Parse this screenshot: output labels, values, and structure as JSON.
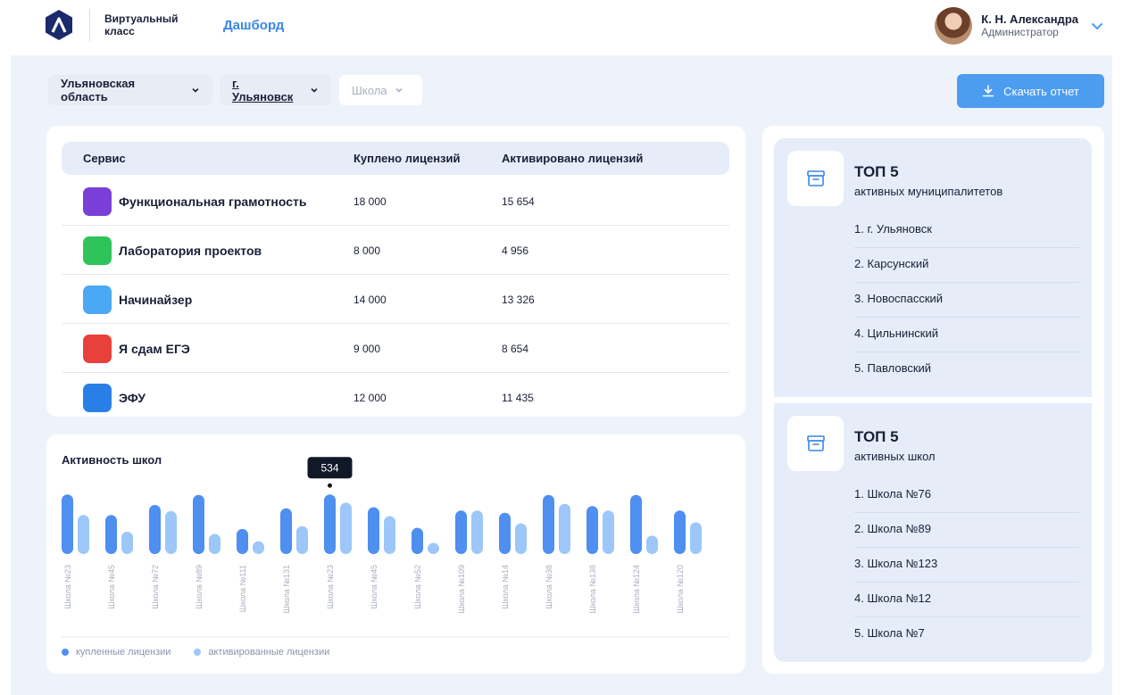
{
  "header": {
    "brand": "Виртуальный класс",
    "nav_dashboard": "Дашборд",
    "user_name": "К. Н. Александра",
    "user_role": "Администратор"
  },
  "filters": {
    "region": "Ульяновская область",
    "city": "г. Ульяновск",
    "school_placeholder": "Школа"
  },
  "download_label": "Скачать отчет",
  "services": {
    "columns": [
      "Сервис",
      "Куплено лицензий",
      "Активировано лицензий"
    ],
    "rows": [
      {
        "name": "Функциональная грамотность",
        "bought": "18 000",
        "activated": "15 654",
        "icon": "puzzle-icon",
        "color": "#7a3fd6"
      },
      {
        "name": "Лаборатория проектов",
        "bought": "8 000",
        "activated": "4 956",
        "icon": "shapes-icon",
        "color": "#2fc45a"
      },
      {
        "name": "Начинайзер",
        "bought": "14 000",
        "activated": "13 326",
        "icon": "kids-icon",
        "color": "#4aa8f5"
      },
      {
        "name": "Я сдам ЕГЭ",
        "bought": "9 000",
        "activated": "8 654",
        "icon": "exam-icon",
        "color": "#e8403a"
      },
      {
        "name": "ЭФУ",
        "bought": "12 000",
        "activated": "11 435",
        "icon": "book-icon",
        "color": "#2a7fe6"
      }
    ]
  },
  "activity": {
    "title": "Активность школ",
    "tooltip_value": "534",
    "legend_bought": "купленные лицензии",
    "legend_activated": "активированные лицензии"
  },
  "chart_data": {
    "type": "bar",
    "categories": [
      "Школа №23",
      "Школа №45",
      "Школа №72",
      "Школа №89",
      "Школа №111",
      "Школа №131",
      "Школа №23",
      "Школа №45",
      "Школа №52",
      "Школа №109",
      "Школа №14",
      "Школа №38",
      "Школа №138",
      "Школа №124",
      "Школа №120"
    ],
    "series": [
      {
        "name": "купленные лицензии",
        "values": [
          534,
          350,
          440,
          530,
          225,
          410,
          534,
          420,
          235,
          390,
          370,
          530,
          430,
          530,
          390
        ]
      },
      {
        "name": "активированные лицензии",
        "values": [
          350,
          200,
          385,
          180,
          115,
          250,
          460,
          340,
          100,
          390,
          275,
          450,
          390,
          165,
          285
        ]
      }
    ],
    "ylim": [
      0,
      560
    ],
    "colors": {
      "bought": "#4e8ff0",
      "activated": "#9cc7f8"
    },
    "highlight_index": 6
  },
  "top_municipalities": {
    "title": "ТОП 5",
    "subtitle": "активных муниципалитетов",
    "items": [
      "1.  г. Ульяновск",
      "2.  Карсунский",
      "3.  Новоспасский",
      "4.  Цильнинский",
      "5.  Павловский"
    ]
  },
  "top_schools": {
    "title": "ТОП 5",
    "subtitle": "активных школ",
    "items": [
      "1.  Школа №76",
      "2.  Школа №89",
      "3.  Школа №123",
      "4.  Школа №12",
      "5.  Школа №7"
    ]
  }
}
